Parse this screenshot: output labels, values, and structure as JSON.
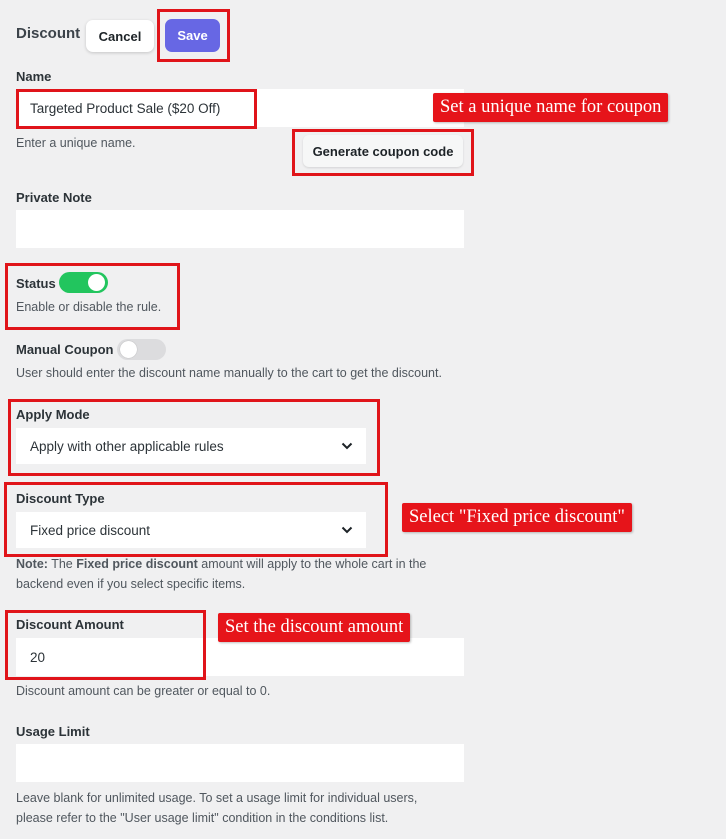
{
  "header": {
    "title": "Discount",
    "cancel_label": "Cancel",
    "save_label": "Save"
  },
  "name_field": {
    "label": "Name",
    "value": "Targeted Product Sale ($20 Off)",
    "help": "Enter a unique name.",
    "generate_label": "Generate coupon code"
  },
  "private_note": {
    "label": "Private Note",
    "value": ""
  },
  "status": {
    "label": "Status",
    "enabled": true,
    "help": "Enable or disable the rule."
  },
  "manual_coupon": {
    "label": "Manual Coupon",
    "enabled": false,
    "help": "User should enter the discount name manually to the cart to get the discount."
  },
  "apply_mode": {
    "label": "Apply Mode",
    "selected": "Apply with other applicable rules"
  },
  "discount_type": {
    "label": "Discount Type",
    "selected": "Fixed price discount",
    "note_prefix": "Note:",
    "note_part1": " The ",
    "note_bold": "Fixed price discount",
    "note_part2": " amount will apply to the whole cart in the",
    "note_line2": "backend even if you select specific items."
  },
  "discount_amount": {
    "label": "Discount Amount",
    "value": "20",
    "help": "Discount amount can be greater or equal to 0."
  },
  "usage_limit": {
    "label": "Usage Limit",
    "value": "",
    "help_line1": "Leave blank for unlimited usage. To set a usage limit for individual users,",
    "help_line2": "please refer to the \"User usage limit\" condition in the conditions list."
  },
  "annotations": {
    "name_callout": "Set a unique name for coupon",
    "type_callout": "Select \"Fixed price discount\"",
    "amount_callout": "Set the discount amount"
  },
  "colors": {
    "accent": "#6767e4",
    "toggle_on": "#22c55e",
    "annotation_red": "#e0141a",
    "background": "#f0f0f1"
  },
  "icons": {
    "select_chevron": "chevron-down-icon"
  }
}
